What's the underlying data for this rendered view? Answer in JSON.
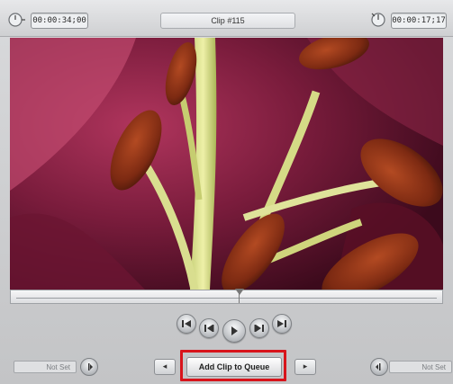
{
  "timecode": {
    "left": "00:00:34;00",
    "right": "00:00:17;17"
  },
  "clip": {
    "title": "Clip #115"
  },
  "transport": {
    "go_to_start_icon": "skip-back-icon",
    "step_back_icon": "step-back-icon",
    "play_icon": "play-icon",
    "step_forward_icon": "step-forward-icon",
    "go_to_end_icon": "skip-forward-icon"
  },
  "bottom_bar": {
    "in_point_value": "Not Set",
    "out_point_value": "Not Set",
    "add_clip_label": "Add Clip to Queue",
    "prev_arrow": "◂",
    "next_arrow": "▸"
  },
  "colors": {
    "highlight": "#d8141b",
    "background": "#c9cacc"
  }
}
